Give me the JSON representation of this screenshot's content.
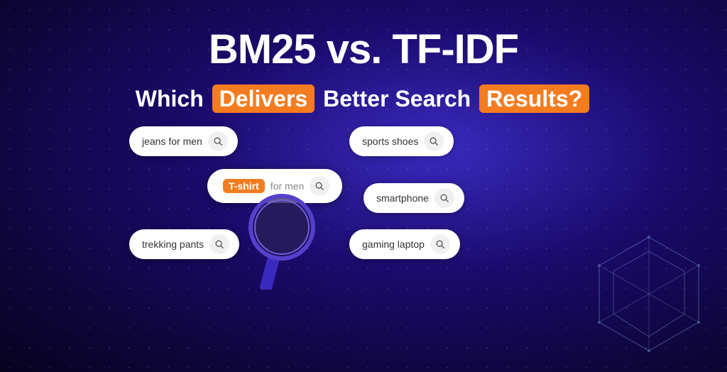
{
  "header": {
    "title": "BM25 vs. TF-IDF",
    "subtitle_prefix": "Which ",
    "subtitle_highlight1": "Delivers",
    "subtitle_middle": " Better Search ",
    "subtitle_highlight2": "Results?",
    "subtitle_suffix": ""
  },
  "search_bars": {
    "jeans": "jeans for men",
    "sports": "sports shoes",
    "featured_highlight": "T-shirt",
    "featured_rest": " for men",
    "smartphone": "smartphone",
    "trekking": "trekking pants",
    "gaming": "gaming laptop"
  },
  "icons": {
    "search": "🔍"
  }
}
